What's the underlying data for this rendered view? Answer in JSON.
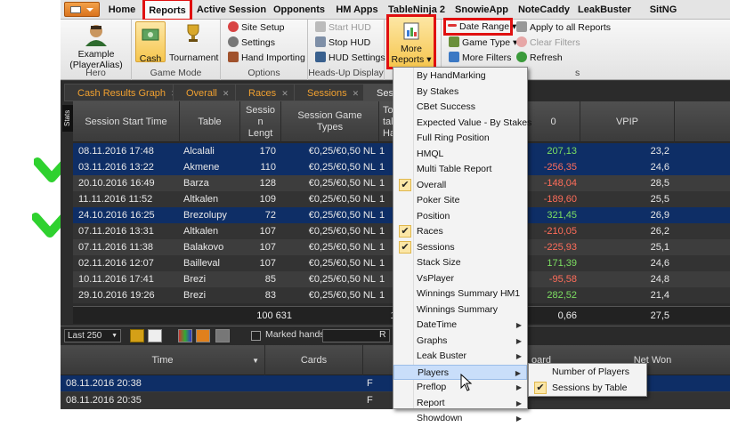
{
  "menubar": {
    "tabs": [
      "Home",
      "Reports",
      "Active Session",
      "Opponents",
      "HM Apps",
      "TableNinja 2",
      "SnowieApp",
      "NoteCaddy",
      "LeakBuster",
      "SitNG"
    ]
  },
  "ribbon": {
    "hero": {
      "name": "Example (PlayerAlias)",
      "name_l1": "Example",
      "name_l2": "(PlayerAlias)",
      "label": "Hero"
    },
    "game_mode": {
      "cash": "Cash",
      "tournament": "Tournament",
      "label": "Game Mode"
    },
    "options": {
      "site_setup": "Site Setup",
      "settings": "Settings",
      "hand_importing": "Hand Importing",
      "label": "Options"
    },
    "hud": {
      "start": "Start HUD",
      "stop": "Stop HUD",
      "settings": "HUD Settings",
      "label": "Heads-Up Display"
    },
    "reports": {
      "more_reports": "More Reports",
      "more_l1": "More",
      "more_l2": "Reports ▾"
    },
    "filters": {
      "date_range": "Date Range ▾",
      "apply_all": "Apply to all Reports",
      "game_type": "Game Type ▾",
      "clear": "Clear Filters",
      "more_filters": "More Filters",
      "refresh": "Refresh",
      "label": "s"
    }
  },
  "report_tabs": [
    "Cash Results Graph",
    "Overall",
    "Races",
    "Sessions",
    "Sessi"
  ],
  "stats_tab": "Stats",
  "table": {
    "headers": [
      "Session Start Time",
      "Table",
      "Session Lengt",
      "Session Game Types",
      "To tal Ha",
      "0",
      "VPIP",
      ""
    ],
    "headers_ml": {
      "len1": "Sessio",
      "len2": "n",
      "len3": "Lengt",
      "gt1": "Session Game",
      "gt2": "Types",
      "h1": "To",
      "h2": "tal",
      "h3": "Ha"
    },
    "rows": [
      {
        "time": "08.11.2016 17:48",
        "table": "Alcalali",
        "len": "170",
        "gt": "€0,25/€0,50 NL",
        "hands": "1",
        "won": "207,13",
        "vpip": "23,2",
        "sign": "pos",
        "sel": true
      },
      {
        "time": "03.11.2016 13:22",
        "table": "Akmene",
        "len": "110",
        "gt": "€0,25/€0,50 NL",
        "hands": "1",
        "won": "-256,35",
        "vpip": "24,6",
        "sign": "neg",
        "sel": true
      },
      {
        "time": "20.10.2016 16:49",
        "table": "Barza",
        "len": "128",
        "gt": "€0,25/€0,50 NL",
        "hands": "1",
        "won": "-148,04",
        "vpip": "28,5",
        "sign": "neg",
        "sel": false
      },
      {
        "time": "11.11.2016 11:52",
        "table": "Altkalen",
        "len": "109",
        "gt": "€0,25/€0,50 NL",
        "hands": "1",
        "won": "-189,60",
        "vpip": "25,5",
        "sign": "neg",
        "sel": false
      },
      {
        "time": "24.10.2016 16:25",
        "table": "Brezolupy",
        "len": "72",
        "gt": "€0,25/€0,50 NL",
        "hands": "1",
        "won": "321,45",
        "vpip": "26,9",
        "sign": "pos",
        "sel": true
      },
      {
        "time": "07.11.2016 13:31",
        "table": "Altkalen",
        "len": "107",
        "gt": "€0,25/€0,50 NL",
        "hands": "1",
        "won": "-210,05",
        "vpip": "26,2",
        "sign": "neg",
        "sel": false
      },
      {
        "time": "07.11.2016 11:38",
        "table": "Balakovo",
        "len": "107",
        "gt": "€0,25/€0,50 NL",
        "hands": "1",
        "won": "-225,93",
        "vpip": "25,1",
        "sign": "neg",
        "sel": false
      },
      {
        "time": "02.11.2016 12:07",
        "table": "Bailleval",
        "len": "107",
        "gt": "€0,25/€0,50 NL",
        "hands": "1",
        "won": "171,39",
        "vpip": "24,6",
        "sign": "pos",
        "sel": false
      },
      {
        "time": "10.11.2016 17:41",
        "table": "Brezi",
        "len": "85",
        "gt": "€0,25/€0,50 NL",
        "hands": "1",
        "won": "-95,58",
        "vpip": "24,8",
        "sign": "neg",
        "sel": false
      },
      {
        "time": "29.10.2016 19:26",
        "table": "Brezi",
        "len": "83",
        "gt": "€0,25/€0,50 NL",
        "hands": "1",
        "won": "282,52",
        "vpip": "21,4",
        "sign": "pos",
        "sel": false
      }
    ],
    "totals": {
      "len": "100 631",
      "hands": "119",
      "won": "0,66",
      "vpip": "27,5"
    }
  },
  "lower": {
    "last_select": "Last 250",
    "marked_hands": "Marked hands",
    "r_label": "R",
    "headers": {
      "time": "Time",
      "cards": "Cards",
      "board": "oard",
      "net_won": "Net Won"
    },
    "rows": [
      {
        "time": "08.11.2016 20:38",
        "f": "F"
      },
      {
        "time": "08.11.2016 20:35",
        "f": "F"
      }
    ]
  },
  "menu": {
    "items": [
      {
        "label": "By HandMarking",
        "check": false,
        "sub": false
      },
      {
        "label": "By Stakes",
        "check": false,
        "sub": false
      },
      {
        "label": "CBet Success",
        "check": false,
        "sub": false
      },
      {
        "label": "Expected Value - By Stakes",
        "check": false,
        "sub": false
      },
      {
        "label": "Full Ring Position",
        "check": false,
        "sub": false
      },
      {
        "label": "HMQL",
        "check": false,
        "sub": false
      },
      {
        "label": "Multi Table Report",
        "check": false,
        "sub": false
      },
      {
        "label": "Overall",
        "check": true,
        "sub": false
      },
      {
        "label": "Poker Site",
        "check": false,
        "sub": false
      },
      {
        "label": "Position",
        "check": false,
        "sub": false
      },
      {
        "label": "Races",
        "check": true,
        "sub": false
      },
      {
        "label": "Sessions",
        "check": true,
        "sub": false
      },
      {
        "label": "Stack Size",
        "check": false,
        "sub": false
      },
      {
        "label": "VsPlayer",
        "check": false,
        "sub": false
      },
      {
        "label": "Winnings Summary HM1",
        "check": false,
        "sub": false
      },
      {
        "label": "Winnings Summary",
        "check": false,
        "sub": false
      },
      {
        "label": "DateTime",
        "check": false,
        "sub": true
      },
      {
        "label": "Graphs",
        "check": false,
        "sub": true
      },
      {
        "label": "Leak Buster",
        "check": false,
        "sub": true
      },
      {
        "label": "Players",
        "check": false,
        "sub": true,
        "hover": true
      },
      {
        "label": "Preflop",
        "check": false,
        "sub": true
      },
      {
        "label": "Report",
        "check": false,
        "sub": true
      },
      {
        "label": "Showdown",
        "check": false,
        "sub": true
      }
    ],
    "check_glyph": "✔",
    "sub_glyph": "▶"
  },
  "submenu": {
    "items": [
      {
        "label": "Number of Players",
        "check": false
      },
      {
        "label": "Sessions by Table",
        "check": true
      }
    ]
  },
  "colors": {
    "accent_highlight": "#e01010",
    "green_check": "#2fd12f",
    "positive": "#7ddf62",
    "negative": "#ff6d5a",
    "selected_row": "#0e2e66"
  }
}
